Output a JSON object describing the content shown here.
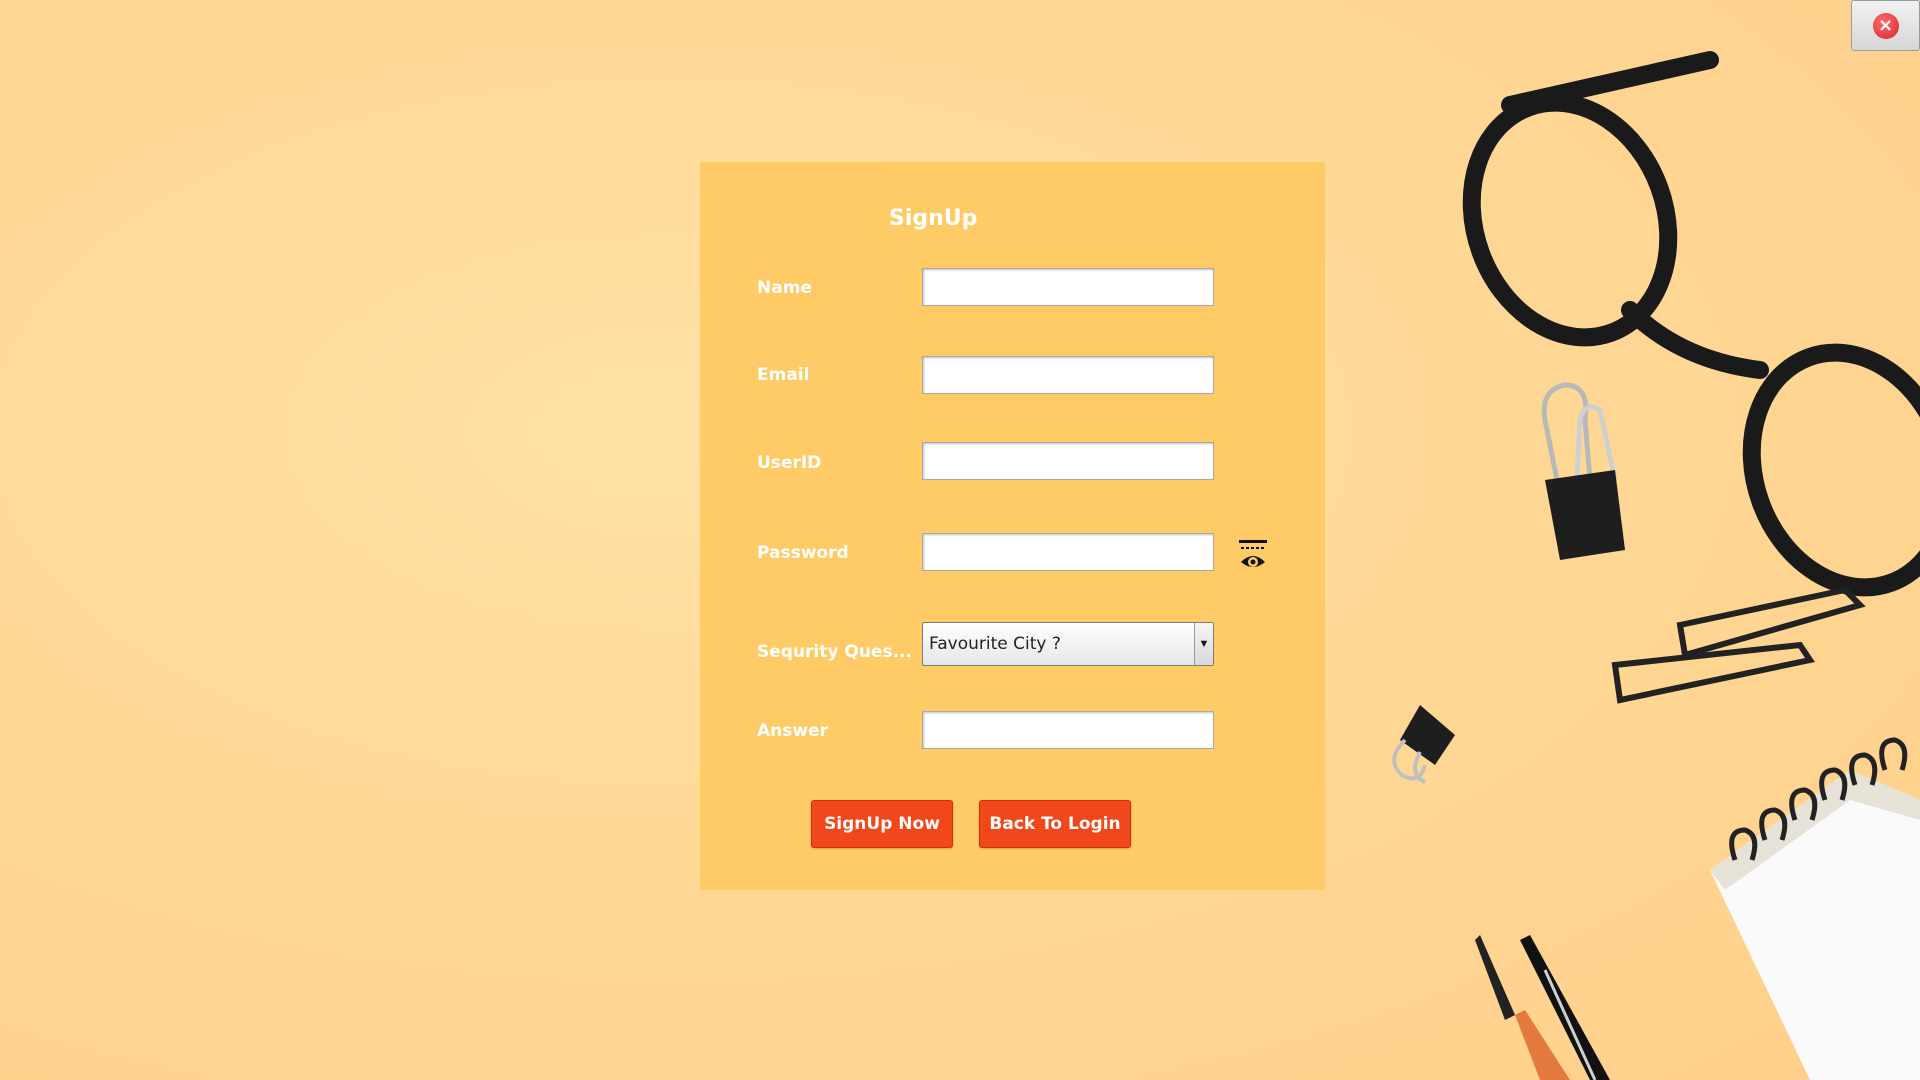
{
  "window": {
    "close_icon": "close-icon",
    "close_glyph": "×"
  },
  "form": {
    "title": "SignUp",
    "fields": [
      {
        "label": "Name",
        "value": ""
      },
      {
        "label": "Email",
        "value": ""
      },
      {
        "label": "UserID",
        "value": ""
      },
      {
        "label": "Password",
        "value": ""
      },
      {
        "label": "Sequrity Ques...",
        "selected": "Favourite City ?"
      },
      {
        "label": "Answer",
        "value": ""
      }
    ],
    "password_toggle_icon": "eye-icon",
    "buttons": {
      "signup": "SignUp Now",
      "back": "Back To Login"
    }
  },
  "colors": {
    "background": "#ffd896",
    "panel": "#ffcb66",
    "button": "#f2461b",
    "close_button": "#d9262d"
  }
}
